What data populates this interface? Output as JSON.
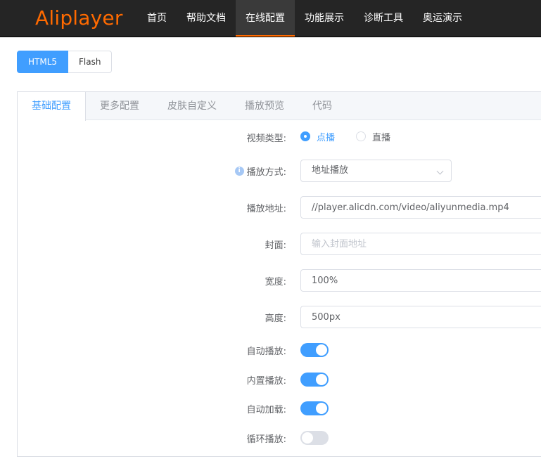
{
  "header": {
    "logo": "Aliplayer",
    "nav": [
      {
        "label": "首页",
        "active": false
      },
      {
        "label": "帮助文档",
        "active": false
      },
      {
        "label": "在线配置",
        "active": true
      },
      {
        "label": "功能展示",
        "active": false
      },
      {
        "label": "诊断工具",
        "active": false
      },
      {
        "label": "奥运演示",
        "active": false
      }
    ],
    "accent_color": "#ff6a00"
  },
  "mode": {
    "options": [
      "HTML5",
      "Flash"
    ],
    "selected": "HTML5"
  },
  "tabs": [
    {
      "label": "基础配置",
      "active": true
    },
    {
      "label": "更多配置",
      "active": false
    },
    {
      "label": "皮肤自定义",
      "active": false
    },
    {
      "label": "播放预览",
      "active": false
    },
    {
      "label": "代码",
      "active": false
    }
  ],
  "form": {
    "video_type": {
      "label": "视频类型:",
      "options": [
        {
          "label": "点播",
          "checked": true
        },
        {
          "label": "直播",
          "checked": false
        }
      ]
    },
    "play_method": {
      "label": "播放方式:",
      "value": "地址播放",
      "icon": "info-icon"
    },
    "play_url": {
      "label": "播放地址:",
      "value": "//player.alicdn.com/video/aliyunmedia.mp4"
    },
    "cover": {
      "label": "封面:",
      "value": "",
      "placeholder": "输入封面地址"
    },
    "width": {
      "label": "宽度:",
      "value": "100%"
    },
    "height": {
      "label": "高度:",
      "value": "500px"
    },
    "autoplay": {
      "label": "自动播放:",
      "on": true
    },
    "inline_play": {
      "label": "内置播放:",
      "on": true
    },
    "autoload": {
      "label": "自动加载:",
      "on": true
    },
    "loop": {
      "label": "循环播放:",
      "on": false
    }
  },
  "colors": {
    "primary": "#409eff",
    "topbar": "#252525"
  }
}
